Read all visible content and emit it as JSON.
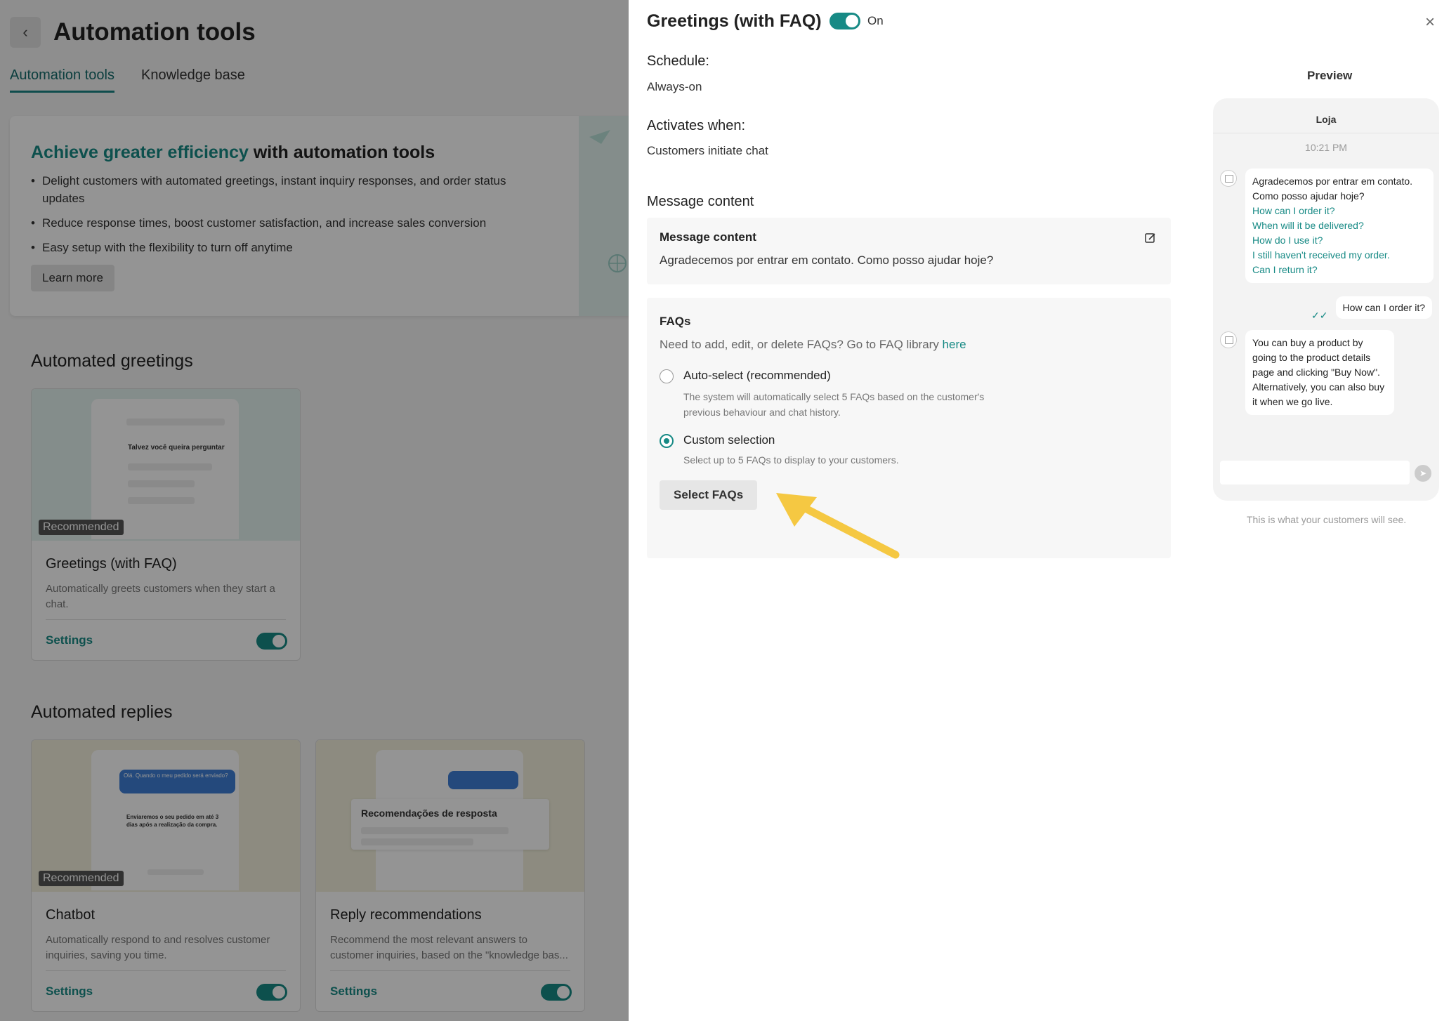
{
  "background": {
    "title": "Automation tools",
    "tabs": [
      "Automation tools",
      "Knowledge base"
    ],
    "banner": {
      "title_accent": "Achieve greater efficiency",
      "title_rest": " with automation tools",
      "bullets": [
        "Delight customers with automated greetings, instant inquiry responses, and order status updates",
        "Reduce response times, boost customer satisfaction, and increase sales conversion",
        "Easy setup with the flexibility to turn off anytime"
      ],
      "learn_more": "Learn more"
    },
    "greetings_section": "Automated greetings",
    "replies_section": "Automated replies",
    "cards": [
      {
        "title": "Greetings (with FAQ)",
        "desc": "Automatically greets customers when they start a chat.",
        "badge": "Recommended",
        "settings": "Settings",
        "mock_text": "Talvez você queira perguntar"
      },
      {
        "title": "Chatbot",
        "desc": "Automatically respond to and resolves customer inquiries, saving you time.",
        "badge": "Recommended",
        "settings": "Settings",
        "mock_question": "Olá. Quando o meu pedido será enviado?",
        "mock_answer": "Enviaremos o seu pedido em até 3 dias após a realização da compra."
      },
      {
        "title": "Reply recommendations",
        "desc": "Recommend the most relevant answers to customer inquiries, based on the \"knowledge bas...",
        "settings": "Settings",
        "mock_text": "Recomendações de resposta"
      }
    ]
  },
  "drawer": {
    "title": "Greetings (with FAQ)",
    "toggle_label": "On",
    "schedule_label": "Schedule:",
    "schedule_value": "Always-on",
    "activates_label": "Activates when:",
    "activates_value": "Customers initiate chat",
    "message_section": "Message content",
    "message_box_title": "Message content",
    "message_text": "Agradecemos por entrar em contato. Como posso ajudar hoje?",
    "faq_title": "FAQs",
    "faq_hint": "Need to add, edit, or delete FAQs? Go to FAQ library ",
    "faq_hint_link": "here",
    "option_auto_label": "Auto-select (recommended)",
    "option_auto_desc": "The system will automatically select 5 FAQs based on the customer's previous behaviour and chat history.",
    "option_custom_label": "Custom selection",
    "option_custom_desc": "Select up to 5 FAQs to display to your customers.",
    "select_button": "Select FAQs",
    "accent_color": "#178a85",
    "arrow_color": "#f5c842"
  },
  "preview": {
    "label": "Preview",
    "shop_name": "Loja",
    "time": "10:21 PM",
    "greeting": "Agradecemos por entrar em contato. Como posso ajudar hoje?",
    "faqs": [
      "How can I order it?",
      "When will it be delivered?",
      "How do I use it?",
      "I still haven't received my order.",
      "Can I return it?"
    ],
    "user_message": "How can I order it?",
    "bot_reply": "You can buy a product by going to the product details page and clicking \"Buy Now\". Alternatively, you can also buy it when we go live.",
    "caption": "This is what your customers will see."
  }
}
